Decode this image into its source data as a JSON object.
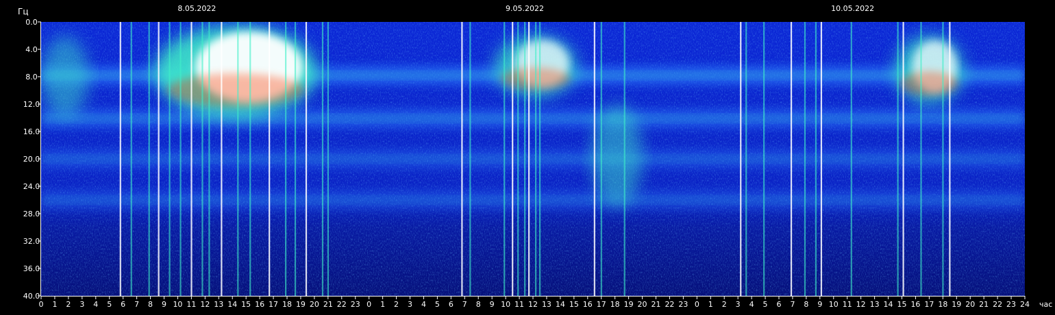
{
  "chart_data": {
    "type": "heatmap",
    "title": "",
    "ylabel": "Гц",
    "xlabel": "час",
    "ylim": [
      0,
      40
    ],
    "y_inverted": true,
    "y_ticks": [
      "0.0",
      "4.0",
      "8.0",
      "12.0",
      "16.0",
      "20.0",
      "24.0",
      "28.0",
      "32.0",
      "36.0",
      "40.0"
    ],
    "x_hours_total": 72,
    "x_ticks": [
      "0",
      "1",
      "2",
      "3",
      "4",
      "5",
      "6",
      "7",
      "8",
      "9",
      "10",
      "11",
      "12",
      "13",
      "14",
      "15",
      "16",
      "17",
      "18",
      "19",
      "20",
      "21",
      "22",
      "23",
      "0",
      "1",
      "2",
      "3",
      "4",
      "5",
      "6",
      "7",
      "8",
      "9",
      "10",
      "11",
      "12",
      "13",
      "14",
      "15",
      "16",
      "17",
      "18",
      "19",
      "20",
      "21",
      "22",
      "23",
      "0",
      "1",
      "2",
      "3",
      "4",
      "5",
      "6",
      "7",
      "8",
      "9",
      "10",
      "11",
      "12",
      "13",
      "14",
      "15",
      "16",
      "17",
      "18",
      "19",
      "20",
      "21",
      "22",
      "23",
      "24"
    ],
    "dates": [
      {
        "label": "8.05.2022",
        "hour": 12
      },
      {
        "label": "9.05.2022",
        "hour": 36
      },
      {
        "label": "10.05.2022",
        "hour": 60
      }
    ],
    "colors": {
      "background": "#000000",
      "plot_base": "#0a1fbf",
      "deep": "#06128a",
      "band": "#2f86ff",
      "high": "#3ff0c8",
      "peak": "#ffffff",
      "hot": "#ff3a00"
    },
    "resonance_bands_hz": [
      {
        "hz": 7.8,
        "intensity": 0.55
      },
      {
        "hz": 14.1,
        "intensity": 0.45
      },
      {
        "hz": 20.0,
        "intensity": 0.32
      },
      {
        "hz": 26.0,
        "intensity": 0.3
      }
    ],
    "bursts": [
      {
        "hour_start": 8.3,
        "hour_end": 20.2,
        "hz_min": 0.5,
        "hz_max": 14.0,
        "level": "saturated"
      },
      {
        "hour_start": 33.2,
        "hour_end": 39.2,
        "hz_min": 2.0,
        "hz_max": 11.0,
        "level": "high"
      },
      {
        "hour_start": 40.3,
        "hour_end": 44.0,
        "hz_min": 12.0,
        "hz_max": 27.0,
        "level": "moderate"
      },
      {
        "hour_start": 62.5,
        "hour_end": 67.5,
        "hz_min": 2.0,
        "hz_max": 12.0,
        "level": "high"
      },
      {
        "hour_start": 0.0,
        "hour_end": 3.5,
        "hz_min": 2.0,
        "hz_max": 14.0,
        "level": "moderate"
      }
    ],
    "spikes_hour": [
      5.8,
      6.6,
      7.9,
      8.6,
      9.4,
      10.2,
      11.0,
      11.8,
      12.3,
      13.2,
      14.4,
      15.3,
      16.7,
      17.9,
      18.6,
      19.4,
      20.6,
      21.0,
      30.8,
      31.4,
      33.9,
      34.5,
      34.9,
      35.4,
      35.7,
      36.2,
      36.5,
      40.5,
      41.0,
      42.7,
      51.2,
      51.6,
      52.9,
      54.9,
      55.9,
      56.7,
      57.1,
      59.3,
      62.7,
      63.1,
      64.4,
      66.0,
      66.5
    ]
  }
}
